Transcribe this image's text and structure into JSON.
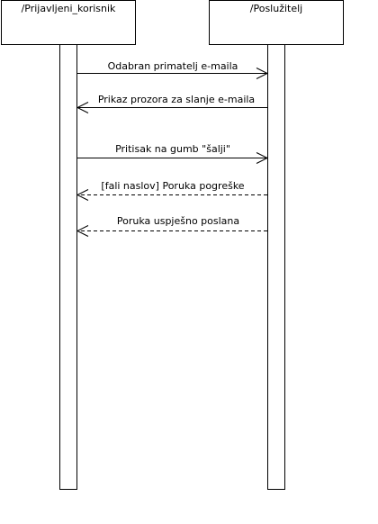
{
  "participants": [
    {
      "name": "/Prijavljeni_korisnik"
    },
    {
      "name": "/Poslužitelj"
    }
  ],
  "messages": [
    {
      "label": "Odabran primatelj e-maila",
      "direction": "right",
      "style": "solid"
    },
    {
      "label": "Prikaz prozora za slanje e-maila",
      "direction": "left",
      "style": "solid"
    },
    {
      "label": "Pritisak na gumb \"šalji\"",
      "direction": "right",
      "style": "solid"
    },
    {
      "label": "[fali naslov] Poruka pogreške",
      "direction": "left",
      "style": "dashed"
    },
    {
      "label": "Poruka uspješno poslana",
      "direction": "left",
      "style": "dashed"
    }
  ]
}
